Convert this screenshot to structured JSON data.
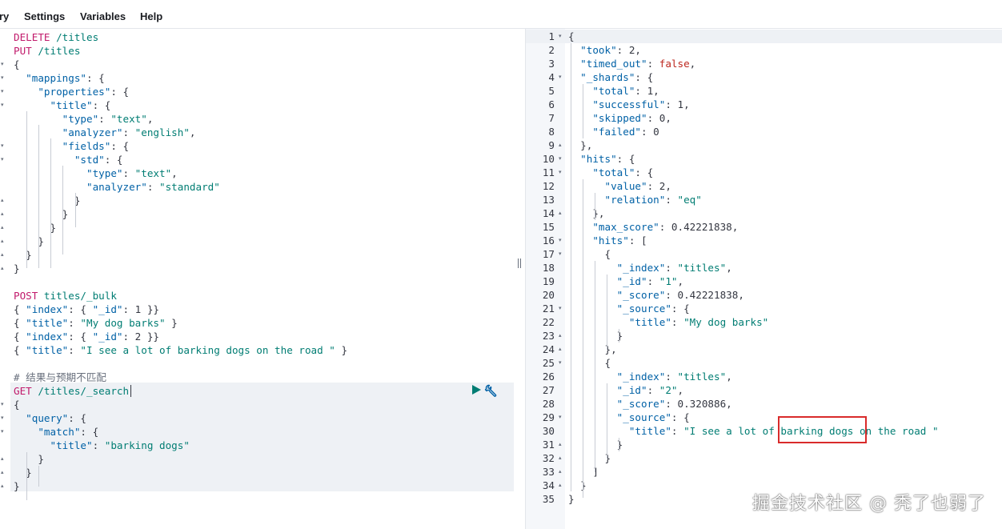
{
  "menu": {
    "items": [
      "ry",
      "Settings",
      "Variables",
      "Help"
    ]
  },
  "colors": {
    "method": "#c11a6b",
    "key": "#0061a6",
    "string": "#017d73",
    "boolean": "#bd271e",
    "run_button": "#017d73",
    "wrench": "#0061a6",
    "highlight_box": "#d92b2b"
  },
  "request_editor": {
    "lines": [
      [
        [
          "m",
          "DELETE "
        ],
        [
          "s",
          "/titles"
        ]
      ],
      [
        [
          "m",
          "PUT "
        ],
        [
          "s",
          "/titles"
        ]
      ],
      [
        [
          "p",
          "{"
        ]
      ],
      [
        [
          "p",
          "  "
        ],
        [
          "k",
          "\"mappings\""
        ],
        [
          "p",
          ": {"
        ]
      ],
      [
        [
          "p",
          "    "
        ],
        [
          "k",
          "\"properties\""
        ],
        [
          "p",
          ": {"
        ]
      ],
      [
        [
          "p",
          "      "
        ],
        [
          "k",
          "\"title\""
        ],
        [
          "p",
          ": {"
        ]
      ],
      [
        [
          "p",
          "        "
        ],
        [
          "k",
          "\"type\""
        ],
        [
          "p",
          ": "
        ],
        [
          "s",
          "\"text\""
        ],
        [
          "p",
          ","
        ]
      ],
      [
        [
          "p",
          "        "
        ],
        [
          "k",
          "\"analyzer\""
        ],
        [
          "p",
          ": "
        ],
        [
          "s",
          "\"english\""
        ],
        [
          "p",
          ","
        ]
      ],
      [
        [
          "p",
          "        "
        ],
        [
          "k",
          "\"fields\""
        ],
        [
          "p",
          ": {"
        ]
      ],
      [
        [
          "p",
          "          "
        ],
        [
          "k",
          "\"std\""
        ],
        [
          "p",
          ": {"
        ]
      ],
      [
        [
          "p",
          "            "
        ],
        [
          "k",
          "\"type\""
        ],
        [
          "p",
          ": "
        ],
        [
          "s",
          "\"text\""
        ],
        [
          "p",
          ","
        ]
      ],
      [
        [
          "p",
          "            "
        ],
        [
          "k",
          "\"analyzer\""
        ],
        [
          "p",
          ": "
        ],
        [
          "s",
          "\"standard\""
        ]
      ],
      [
        [
          "p",
          "          }"
        ]
      ],
      [
        [
          "p",
          "        }"
        ]
      ],
      [
        [
          "p",
          "      }"
        ]
      ],
      [
        [
          "p",
          "    }"
        ]
      ],
      [
        [
          "p",
          "  }"
        ]
      ],
      [
        [
          "p",
          "}"
        ]
      ],
      [],
      [
        [
          "m",
          "POST "
        ],
        [
          "s",
          "titles/_bulk"
        ]
      ],
      [
        [
          "p",
          "{ "
        ],
        [
          "k",
          "\"index\""
        ],
        [
          "p",
          ": { "
        ],
        [
          "k",
          "\"_id\""
        ],
        [
          "p",
          ": 1 }}"
        ]
      ],
      [
        [
          "p",
          "{ "
        ],
        [
          "k",
          "\"title\""
        ],
        [
          "p",
          ": "
        ],
        [
          "s",
          "\"My dog barks\""
        ],
        [
          "p",
          " }"
        ]
      ],
      [
        [
          "p",
          "{ "
        ],
        [
          "k",
          "\"index\""
        ],
        [
          "p",
          ": { "
        ],
        [
          "k",
          "\"_id\""
        ],
        [
          "p",
          ": 2 }}"
        ]
      ],
      [
        [
          "p",
          "{ "
        ],
        [
          "k",
          "\"title\""
        ],
        [
          "p",
          ": "
        ],
        [
          "s",
          "\"I see a lot of barking dogs on the road \""
        ],
        [
          "p",
          " }"
        ]
      ],
      [],
      [
        [
          "c",
          "# 结果与预期不匹配"
        ]
      ],
      [
        [
          "m",
          "GET "
        ],
        [
          "s",
          "/titles/_search"
        ]
      ],
      [
        [
          "p",
          "{"
        ]
      ],
      [
        [
          "p",
          "  "
        ],
        [
          "k",
          "\"query\""
        ],
        [
          "p",
          ": {"
        ]
      ],
      [
        [
          "p",
          "    "
        ],
        [
          "k",
          "\"match\""
        ],
        [
          "p",
          ": {"
        ]
      ],
      [
        [
          "p",
          "      "
        ],
        [
          "k",
          "\"title\""
        ],
        [
          "p",
          ": "
        ],
        [
          "s",
          "\"barking dogs\""
        ]
      ],
      [
        [
          "p",
          "    }"
        ]
      ],
      [
        [
          "p",
          "  }"
        ]
      ],
      [
        [
          "p",
          "}"
        ]
      ]
    ],
    "folds": [
      "",
      "",
      "open",
      "open",
      "open",
      "open",
      "",
      "",
      "open",
      "open",
      "",
      "",
      "close",
      "close",
      "close",
      "close",
      "close",
      "close",
      "",
      "",
      "",
      "",
      "",
      "",
      "",
      "",
      "",
      "open",
      "open",
      "open",
      "",
      "close",
      "close",
      "close"
    ]
  },
  "response_editor": {
    "line_numbers": [
      "1",
      "2",
      "3",
      "4",
      "5",
      "6",
      "7",
      "8",
      "9",
      "10",
      "11",
      "12",
      "13",
      "14",
      "15",
      "16",
      "17",
      "18",
      "19",
      "20",
      "21",
      "22",
      "23",
      "24",
      "25",
      "26",
      "27",
      "28",
      "29",
      "30",
      "31",
      "32",
      "33",
      "34",
      "35"
    ],
    "folds": [
      "open",
      "",
      "",
      "open",
      "",
      "",
      "",
      "",
      "close",
      "open",
      "open",
      "",
      "",
      "close",
      "",
      "open",
      "open",
      "",
      "",
      "",
      "open",
      "",
      "close",
      "close",
      "open",
      "",
      "",
      "",
      "open",
      "",
      "close",
      "close",
      "close",
      "close",
      ""
    ],
    "lines": [
      [
        [
          "p",
          "{"
        ]
      ],
      [
        [
          "p",
          "  "
        ],
        [
          "k",
          "\"took\""
        ],
        [
          "p",
          ": 2,"
        ]
      ],
      [
        [
          "p",
          "  "
        ],
        [
          "k",
          "\"timed_out\""
        ],
        [
          "p",
          ": "
        ],
        [
          "b",
          "false"
        ],
        [
          "p",
          ","
        ]
      ],
      [
        [
          "p",
          "  "
        ],
        [
          "k",
          "\"_shards\""
        ],
        [
          "p",
          ": {"
        ]
      ],
      [
        [
          "p",
          "    "
        ],
        [
          "k",
          "\"total\""
        ],
        [
          "p",
          ": 1,"
        ]
      ],
      [
        [
          "p",
          "    "
        ],
        [
          "k",
          "\"successful\""
        ],
        [
          "p",
          ": 1,"
        ]
      ],
      [
        [
          "p",
          "    "
        ],
        [
          "k",
          "\"skipped\""
        ],
        [
          "p",
          ": 0,"
        ]
      ],
      [
        [
          "p",
          "    "
        ],
        [
          "k",
          "\"failed\""
        ],
        [
          "p",
          ": 0"
        ]
      ],
      [
        [
          "p",
          "  },"
        ]
      ],
      [
        [
          "p",
          "  "
        ],
        [
          "k",
          "\"hits\""
        ],
        [
          "p",
          ": {"
        ]
      ],
      [
        [
          "p",
          "    "
        ],
        [
          "k",
          "\"total\""
        ],
        [
          "p",
          ": {"
        ]
      ],
      [
        [
          "p",
          "      "
        ],
        [
          "k",
          "\"value\""
        ],
        [
          "p",
          ": 2,"
        ]
      ],
      [
        [
          "p",
          "      "
        ],
        [
          "k",
          "\"relation\""
        ],
        [
          "p",
          ": "
        ],
        [
          "s",
          "\"eq\""
        ]
      ],
      [
        [
          "p",
          "    },"
        ]
      ],
      [
        [
          "p",
          "    "
        ],
        [
          "k",
          "\"max_score\""
        ],
        [
          "p",
          ": 0.42221838,"
        ]
      ],
      [
        [
          "p",
          "    "
        ],
        [
          "k",
          "\"hits\""
        ],
        [
          "p",
          ": ["
        ]
      ],
      [
        [
          "p",
          "      {"
        ]
      ],
      [
        [
          "p",
          "        "
        ],
        [
          "k",
          "\"_index\""
        ],
        [
          "p",
          ": "
        ],
        [
          "s",
          "\"titles\""
        ],
        [
          "p",
          ","
        ]
      ],
      [
        [
          "p",
          "        "
        ],
        [
          "k",
          "\"_id\""
        ],
        [
          "p",
          ": "
        ],
        [
          "s",
          "\"1\""
        ],
        [
          "p",
          ","
        ]
      ],
      [
        [
          "p",
          "        "
        ],
        [
          "k",
          "\"_score\""
        ],
        [
          "p",
          ": 0.42221838,"
        ]
      ],
      [
        [
          "p",
          "        "
        ],
        [
          "k",
          "\"_source\""
        ],
        [
          "p",
          ": {"
        ]
      ],
      [
        [
          "p",
          "          "
        ],
        [
          "k",
          "\"title\""
        ],
        [
          "p",
          ": "
        ],
        [
          "s",
          "\"My dog barks\""
        ]
      ],
      [
        [
          "p",
          "        }"
        ]
      ],
      [
        [
          "p",
          "      },"
        ]
      ],
      [
        [
          "p",
          "      {"
        ]
      ],
      [
        [
          "p",
          "        "
        ],
        [
          "k",
          "\"_index\""
        ],
        [
          "p",
          ": "
        ],
        [
          "s",
          "\"titles\""
        ],
        [
          "p",
          ","
        ]
      ],
      [
        [
          "p",
          "        "
        ],
        [
          "k",
          "\"_id\""
        ],
        [
          "p",
          ": "
        ],
        [
          "s",
          "\"2\""
        ],
        [
          "p",
          ","
        ]
      ],
      [
        [
          "p",
          "        "
        ],
        [
          "k",
          "\"_score\""
        ],
        [
          "p",
          ": 0.320886,"
        ]
      ],
      [
        [
          "p",
          "        "
        ],
        [
          "k",
          "\"_source\""
        ],
        [
          "p",
          ": {"
        ]
      ],
      [
        [
          "p",
          "          "
        ],
        [
          "k",
          "\"title\""
        ],
        [
          "p",
          ": "
        ],
        [
          "s",
          "\"I see a lot of barking dogs on the road \""
        ]
      ],
      [
        [
          "p",
          "        }"
        ]
      ],
      [
        [
          "p",
          "      }"
        ]
      ],
      [
        [
          "p",
          "    ]"
        ]
      ],
      [
        [
          "p",
          "  }"
        ]
      ],
      [
        [
          "p",
          "}"
        ]
      ]
    ]
  },
  "watermark": "掘金技术社区 @ 秃了也弱了"
}
